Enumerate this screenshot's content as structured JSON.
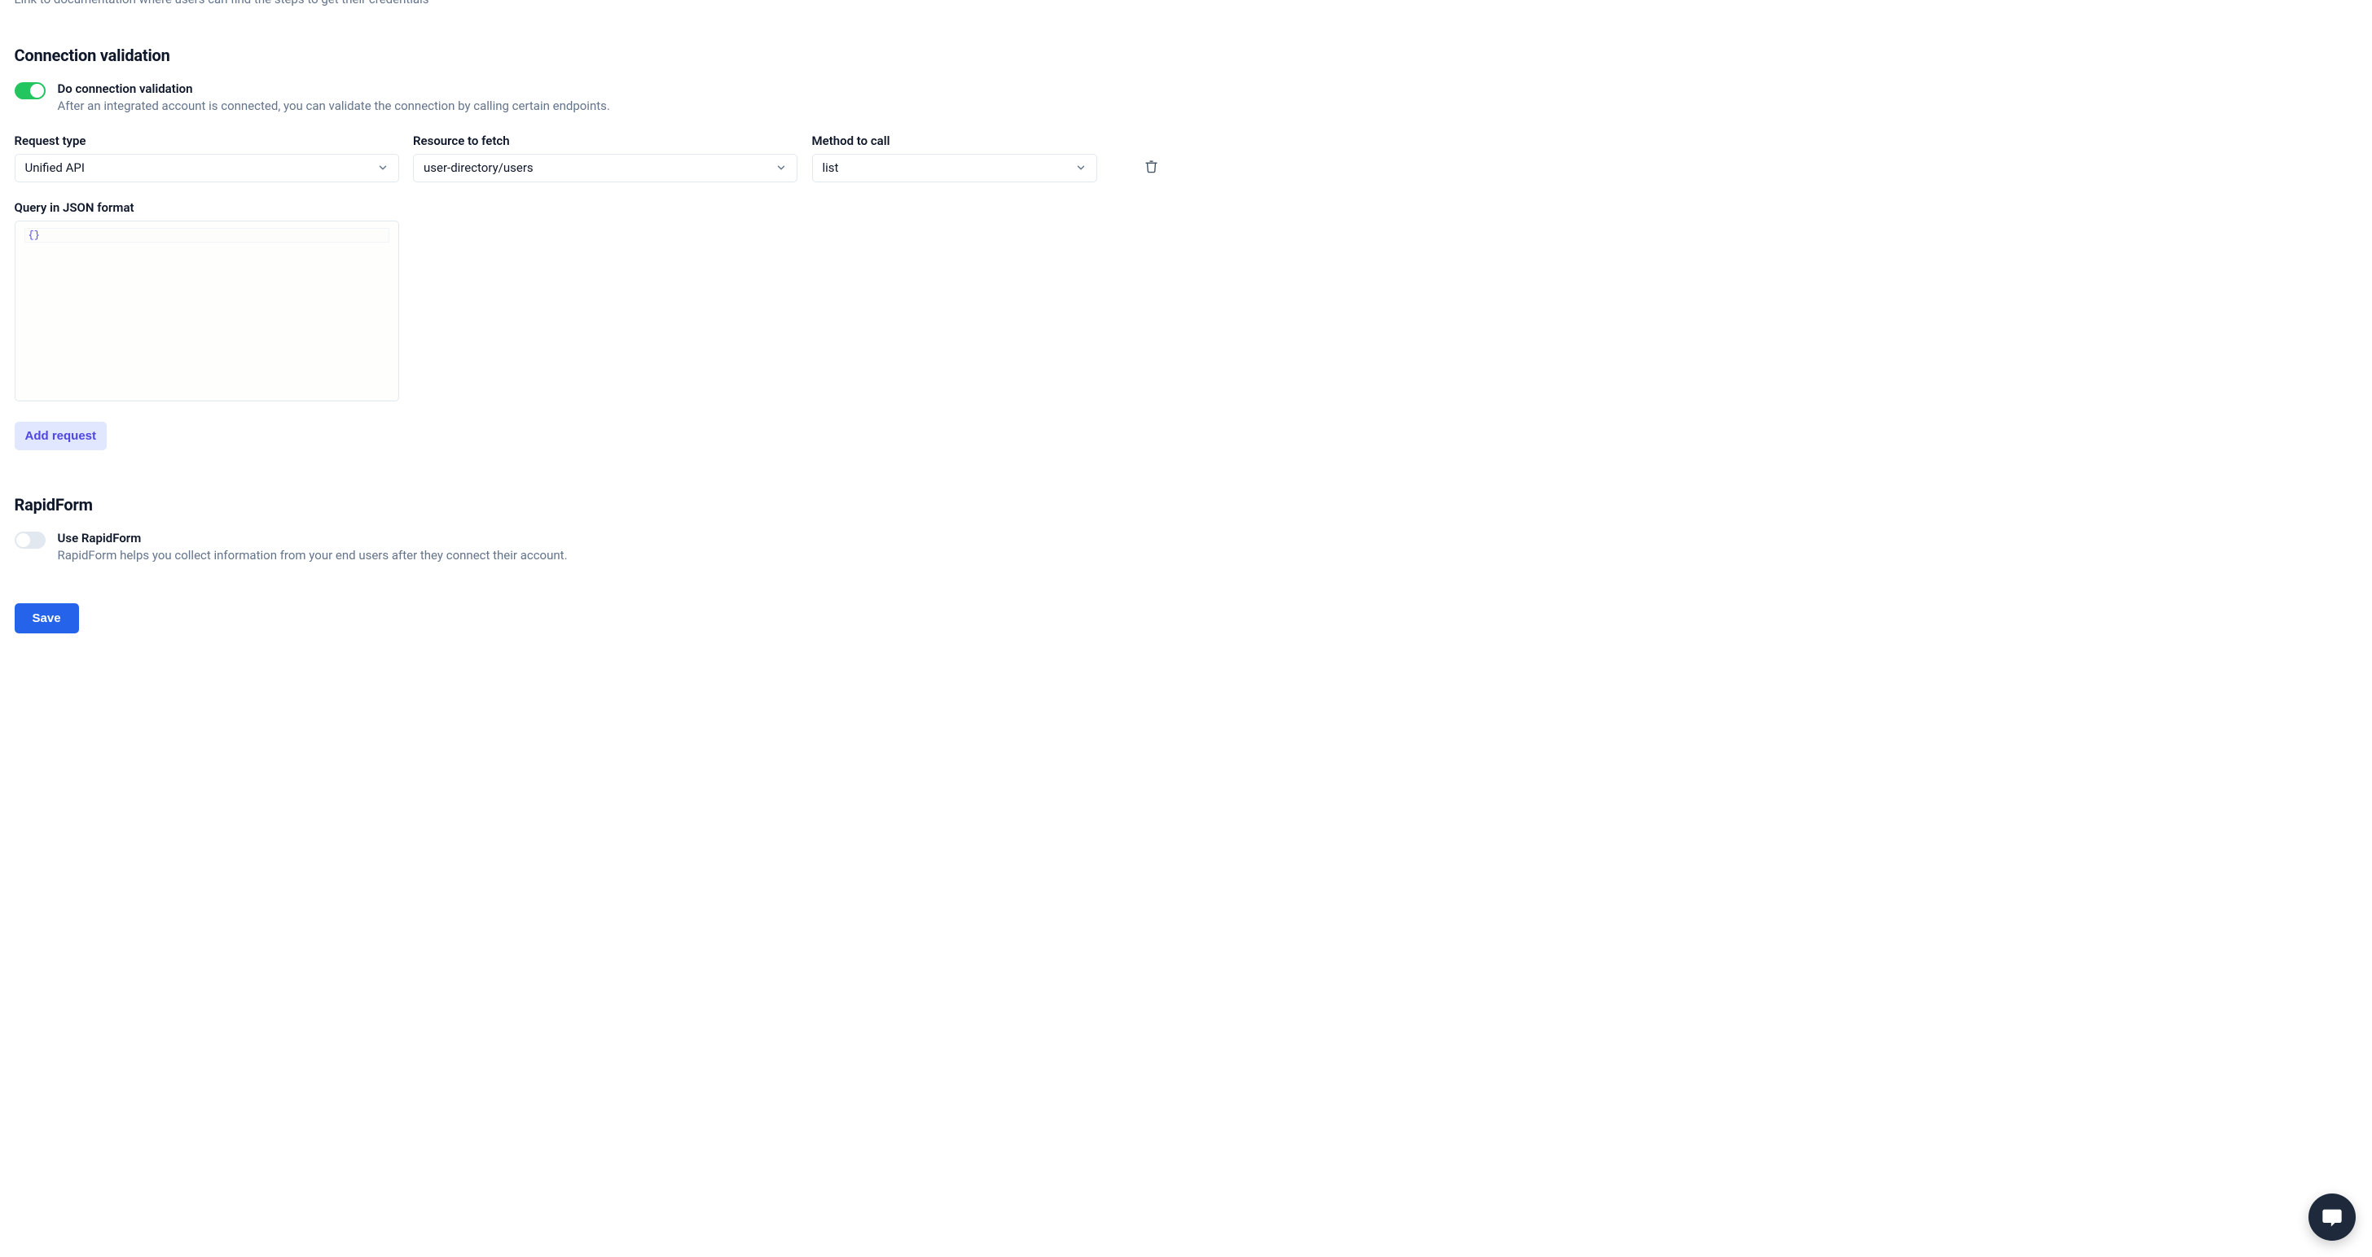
{
  "partial_top_text": "Link to documentation where users can find the steps to get their credentials",
  "connection_validation": {
    "title": "Connection validation",
    "toggle_label": "Do connection validation",
    "toggle_desc": "After an integrated account is connected, you can validate the connection by calling certain endpoints.",
    "toggle_on": true,
    "fields": {
      "request_type": {
        "label": "Request type",
        "value": "Unified API"
      },
      "resource_to_fetch": {
        "label": "Resource to fetch",
        "value": "user-directory/users"
      },
      "method_to_call": {
        "label": "Method to call",
        "value": "list"
      }
    },
    "query_label": "Query in JSON format",
    "query_value": "{}",
    "add_request_label": "Add request"
  },
  "rapidform": {
    "title": "RapidForm",
    "toggle_label": "Use RapidForm",
    "toggle_desc": "RapidForm helps you collect information from your end users after they connect their account.",
    "toggle_on": false
  },
  "save_label": "Save"
}
